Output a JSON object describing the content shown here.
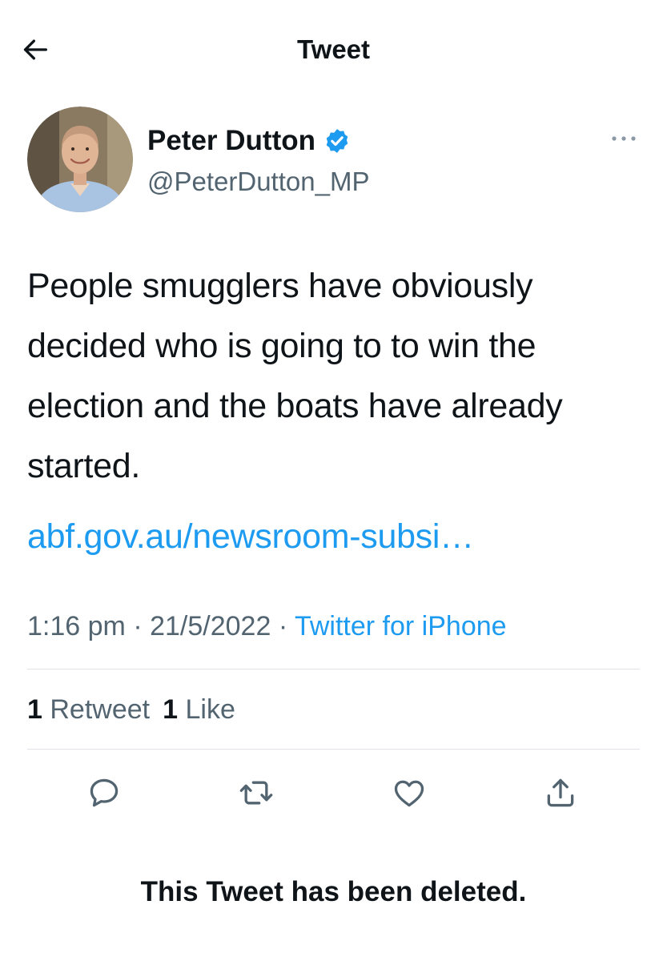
{
  "header": {
    "title": "Tweet",
    "back_icon": "arrow-left-icon"
  },
  "author": {
    "name": "Peter Dutton",
    "handle": "@PeterDutton_MP",
    "verified": true,
    "more_icon": "ellipsis-icon"
  },
  "tweet": {
    "text": "People smugglers have obviously decided who is going to to win the election and the boats have already started.",
    "link": "abf.gov.au/newsroom-subsi…",
    "time": "1:16 pm",
    "date": "21/5/2022",
    "separator": "·",
    "source": "Twitter for iPhone"
  },
  "stats": {
    "retweets_count": "1",
    "retweets_label": "Retweet",
    "likes_count": "1",
    "likes_label": "Like"
  },
  "actions": [
    "reply-icon",
    "retweet-icon",
    "like-icon",
    "share-icon"
  ],
  "notice": "This Tweet has been deleted.",
  "colors": {
    "link": "#1d9bf0",
    "secondary_text": "#536471",
    "divider": "#dfe3e7",
    "verified": "#1d9bf0"
  }
}
